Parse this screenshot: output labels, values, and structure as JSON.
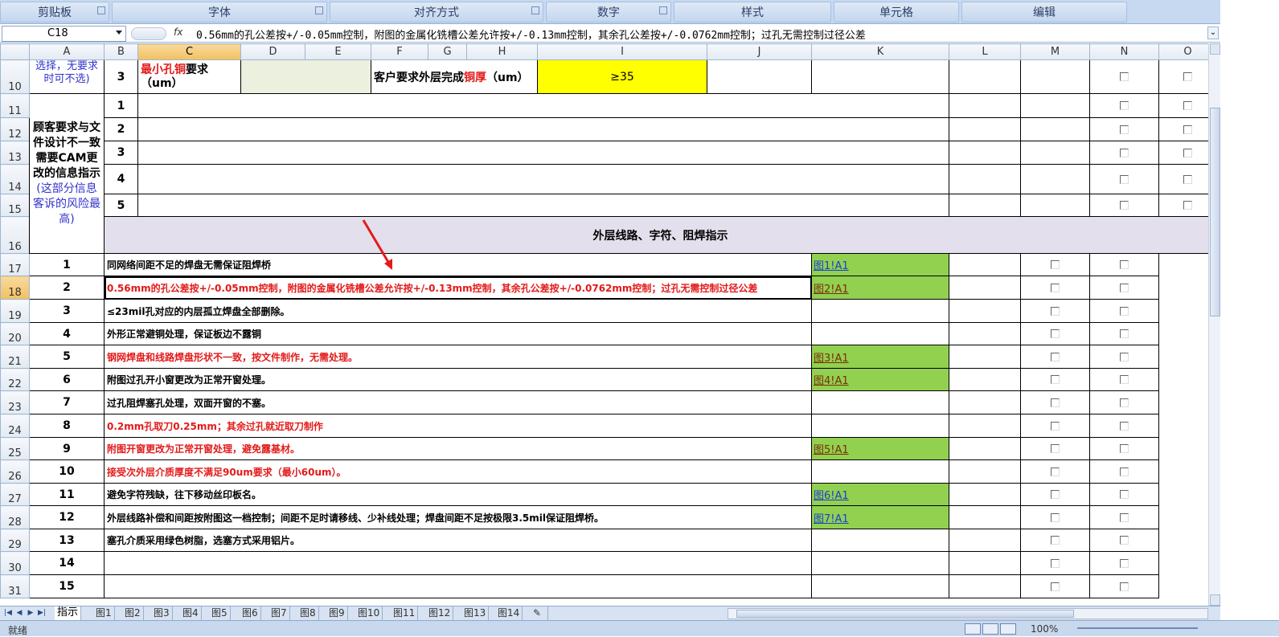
{
  "ribbon": {
    "groups": [
      "剪贴板",
      "字体",
      "对齐方式",
      "数字",
      "样式",
      "单元格",
      "编辑"
    ]
  },
  "formula_bar": {
    "name_box": "C18",
    "fx_label": "fx",
    "content": "0.56mm的孔公差按+/-0.05mm控制，附图的金属化铣槽公差允许按+/-0.13mm控制，其余孔公差按+/-0.0762mm控制；过孔无需控制过径公差"
  },
  "columns": [
    "A",
    "B",
    "C",
    "D",
    "E",
    "F",
    "G",
    "H",
    "I",
    "J",
    "K",
    "L",
    "M",
    "N",
    "O"
  ],
  "selected_column": "C",
  "selected_row": "18",
  "row10": {
    "row_num": "10",
    "a_text": "选择，无要求时可不选)",
    "b_num": "3",
    "c_red": "最小孔铜",
    "c_black": "要求（um）",
    "f_black": "客户要求外层完成",
    "f_red": "铜厚",
    "f_unit": "（um）",
    "i_value": "≥35"
  },
  "empty_rows": [
    {
      "row_num": "11",
      "b_num": "1"
    },
    {
      "row_num": "12",
      "b_num": "2"
    },
    {
      "row_num": "13",
      "b_num": "3"
    },
    {
      "row_num": "14",
      "b_num": "4"
    },
    {
      "row_num": "15",
      "b_num": "5"
    }
  ],
  "section": {
    "row_num": "16",
    "title": "外层线路、字符、阻焊指示"
  },
  "group_label": {
    "main": "顾客要求与文件设计不一致需要CAM更改的信息指示",
    "note": "(这部分信息客诉的风险最高)"
  },
  "items": [
    {
      "row_num": "17",
      "num": "1",
      "text": "同网络间距不足的焊盘无需保证阻焊桥",
      "red": false,
      "link": "图1!A1",
      "link_dark": false
    },
    {
      "row_num": "18",
      "num": "2",
      "text": "0.56mm的孔公差按+/-0.05mm控制，附图的金属化铣槽公差允许按+/-0.13mm控制，其余孔公差按+/-0.0762mm控制；过孔无需控制过径公差",
      "red": true,
      "link": "图2!A1",
      "link_dark": true
    },
    {
      "row_num": "19",
      "num": "3",
      "text": "≤23mil孔对应的内层孤立焊盘全部删除。",
      "red": false,
      "link": "",
      "link_dark": false
    },
    {
      "row_num": "20",
      "num": "4",
      "text": "外形正常避铜处理，保证板边不露铜",
      "red": false,
      "link": "",
      "link_dark": false
    },
    {
      "row_num": "21",
      "num": "5",
      "text": "钢网焊盘和线路焊盘形状不一致，按文件制作，无需处理。",
      "red": true,
      "link": "图3!A1",
      "link_dark": true
    },
    {
      "row_num": "22",
      "num": "6",
      "text": "附图过孔开小窗更改为正常开窗处理。",
      "red": false,
      "link": "图4!A1",
      "link_dark": true
    },
    {
      "row_num": "23",
      "num": "7",
      "text": "过孔阻焊塞孔处理，双面开窗的不塞。",
      "red": false,
      "link": "",
      "link_dark": false
    },
    {
      "row_num": "24",
      "num": "8",
      "text": "0.2mm孔取刀0.25mm；其余过孔就近取刀制作",
      "red": true,
      "link": "",
      "link_dark": false
    },
    {
      "row_num": "25",
      "num": "9",
      "text": "附图开窗更改为正常开窗处理，避免露基材。",
      "red": true,
      "link": "图5!A1",
      "link_dark": true
    },
    {
      "row_num": "26",
      "num": "10",
      "text": "接受次外层介质厚度不满足90um要求（最小60um）。",
      "red": true,
      "link": "",
      "link_dark": false
    },
    {
      "row_num": "27",
      "num": "11",
      "text": "避免字符残缺，往下移动丝印板名。",
      "red": false,
      "link": "图6!A1",
      "link_dark": false
    },
    {
      "row_num": "28",
      "num": "12",
      "text": "外层线路补偿和间距按附图这一档控制；间距不足时请移线、少补线处理；焊盘间距不足按极限3.5mil保证阻焊桥。",
      "red": false,
      "link": "图7!A1",
      "link_dark": false
    },
    {
      "row_num": "29",
      "num": "13",
      "text": "塞孔介质采用绿色树脂，选塞方式采用铝片。",
      "red": false,
      "link": "",
      "link_dark": false
    },
    {
      "row_num": "30",
      "num": "14",
      "text": "",
      "red": false,
      "link": "",
      "link_dark": false
    },
    {
      "row_num": "31",
      "num": "15",
      "text": "",
      "red": false,
      "link": "",
      "link_dark": false
    }
  ],
  "sheet_tabs": [
    "指示",
    "图1",
    "图2",
    "图3",
    "图4",
    "图5",
    "图6",
    "图7",
    "图8",
    "图9",
    "图10",
    "图11",
    "图12",
    "图13",
    "图14"
  ],
  "active_tab": "指示",
  "status": {
    "text": "就绪",
    "zoom": "100%"
  },
  "annotation_arrow_color": "#e31a1a",
  "link_cell_color": "#92d050",
  "section_color": "#e4dfec",
  "highlight_color": "#ffff00",
  "input_cell_color": "#ebf1de"
}
